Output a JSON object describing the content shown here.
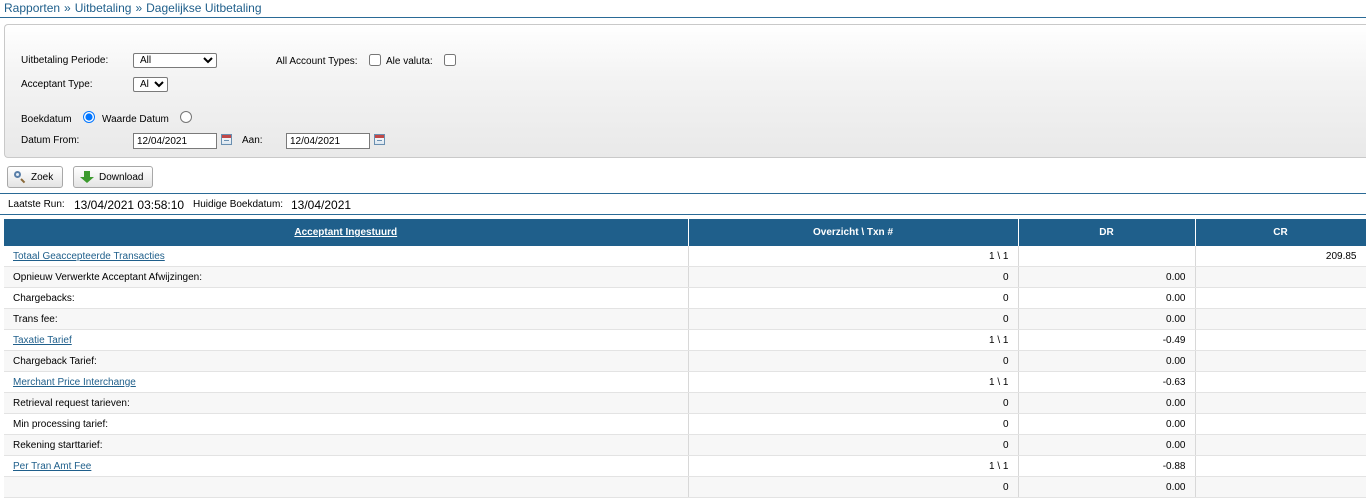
{
  "breadcrumb": {
    "items": [
      "Rapporten",
      "Uitbetaling",
      "Dagelijkse Uitbetaling"
    ],
    "separator": "»"
  },
  "filters": {
    "period_label": "Uitbetaling Periode:",
    "period_value": "All",
    "acceptant_type_label": "Acceptant Type:",
    "acceptant_type_value": "All",
    "account_types_label": "All Account Types:",
    "all_currencies_label": "Ale valuta:",
    "boekdatum_label": "Boekdatum",
    "waarde_datum_label": "Waarde Datum",
    "date_from_label": "Datum From:",
    "date_from_value": "12/04/2021",
    "date_to_label": "Aan:",
    "date_to_value": "12/04/2021"
  },
  "actions": {
    "search_label": "Zoek",
    "download_label": "Download"
  },
  "status": {
    "last_run_label": "Laatste Run:",
    "last_run_value": "13/04/2021 03:58:10",
    "current_date_label": "Huidige Boekdatum:",
    "current_date_value": "13/04/2021"
  },
  "table": {
    "headers": [
      "Acceptant Ingestuurd",
      "Overzicht \\ Txn #",
      "DR",
      "CR"
    ],
    "rows": [
      {
        "name": "Totaal Geaccepteerde Transacties",
        "link": true,
        "txn": "1 \\ 1",
        "dr": "",
        "cr": "209.85"
      },
      {
        "name": "Opnieuw Verwerkte Acceptant Afwijzingen:",
        "link": false,
        "txn": "0",
        "dr": "0.00",
        "cr": ""
      },
      {
        "name": "Chargebacks:",
        "link": false,
        "txn": "0",
        "dr": "0.00",
        "cr": ""
      },
      {
        "name": "Trans fee:",
        "link": false,
        "txn": "0",
        "dr": "0.00",
        "cr": ""
      },
      {
        "name": "Taxatie Tarief",
        "link": true,
        "txn": "1 \\ 1",
        "dr": "-0.49",
        "cr": ""
      },
      {
        "name": "Chargeback Tarief:",
        "link": false,
        "txn": "0",
        "dr": "0.00",
        "cr": ""
      },
      {
        "name": "Merchant Price Interchange",
        "link": true,
        "txn": "1 \\ 1",
        "dr": "-0.63",
        "cr": ""
      },
      {
        "name": "Retrieval request tarieven:",
        "link": false,
        "txn": "0",
        "dr": "0.00",
        "cr": ""
      },
      {
        "name": "Min processing tarief:",
        "link": false,
        "txn": "0",
        "dr": "0.00",
        "cr": ""
      },
      {
        "name": "Rekening starttarief:",
        "link": false,
        "txn": "0",
        "dr": "0.00",
        "cr": ""
      },
      {
        "name": "Per Tran Amt Fee",
        "link": true,
        "txn": "1 \\ 1",
        "dr": "-0.88",
        "cr": ""
      },
      {
        "name": "",
        "link": false,
        "txn": "0",
        "dr": "0.00",
        "cr": ""
      }
    ]
  },
  "colors": {
    "header_bg": "#1f5f8b",
    "link": "#1f5f8b"
  }
}
